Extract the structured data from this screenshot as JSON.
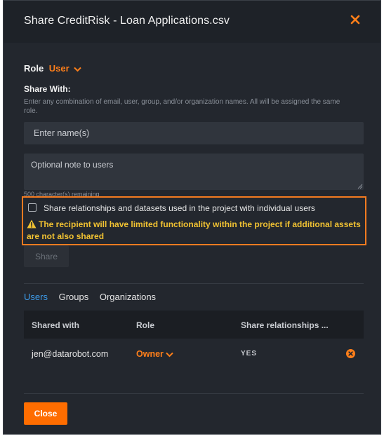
{
  "modal": {
    "title": "Share CreditRisk - Loan Applications.csv",
    "close_icon": "close-x-icon"
  },
  "role": {
    "label": "Role",
    "value": "User"
  },
  "share_with": {
    "label": "Share With:",
    "help": "Enter any combination of email, user, group, and/or organization names. All will be assigned the same role.",
    "name_placeholder": "Enter name(s)",
    "note_placeholder": "Optional note to users",
    "chars_remaining": "500 character(s) remaining"
  },
  "relationships": {
    "checkbox_label": "Share relationships and datasets used in the project with individual users",
    "checked": false,
    "warning": "The recipient will have limited functionality within the project if additional assets are not also shared"
  },
  "share_button": "Share",
  "tabs": [
    {
      "label": "Users",
      "active": true
    },
    {
      "label": "Groups",
      "active": false
    },
    {
      "label": "Organizations",
      "active": false
    }
  ],
  "table": {
    "headers": [
      "Shared with",
      "Role",
      "Share relationships ..."
    ],
    "rows": [
      {
        "email": "jen@datarobot.com",
        "role": "Owner",
        "share_relationships": "YES"
      }
    ]
  },
  "close_button": "Close",
  "colors": {
    "accent": "#ff7f1a",
    "warning": "#f1c232",
    "link": "#3d9be9",
    "background": "#23272e"
  }
}
